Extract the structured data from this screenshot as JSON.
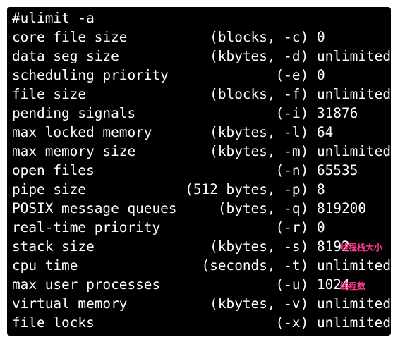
{
  "terminal": {
    "lines": [
      "#ulimit -a",
      "core file size          (blocks, -c) 0",
      "data seg size           (kbytes, -d) unlimited",
      "scheduling priority             (-e) 0",
      "file size               (blocks, -f) unlimited",
      "pending signals                 (-i) 31876",
      "max locked memory       (kbytes, -l) 64",
      "max memory size         (kbytes, -m) unlimited",
      "open files                      (-n) 65535",
      "pipe size            (512 bytes, -p) 8",
      "POSIX message queues     (bytes, -q) 819200",
      "real-time priority              (-r) 0",
      "stack size              (kbytes, -s) 8192",
      "cpu time               (seconds, -t) unlimited",
      "max user processes              (-u) 1024",
      "virtual memory          (kbytes, -v) unlimited",
      "file locks                      (-x) unlimited"
    ],
    "annotations": {
      "stack_note": "线程栈大小",
      "process_note": "线程数"
    },
    "colors": {
      "background": "#000000",
      "text": "#ffffff",
      "annotation": "#ff3b8e"
    }
  }
}
